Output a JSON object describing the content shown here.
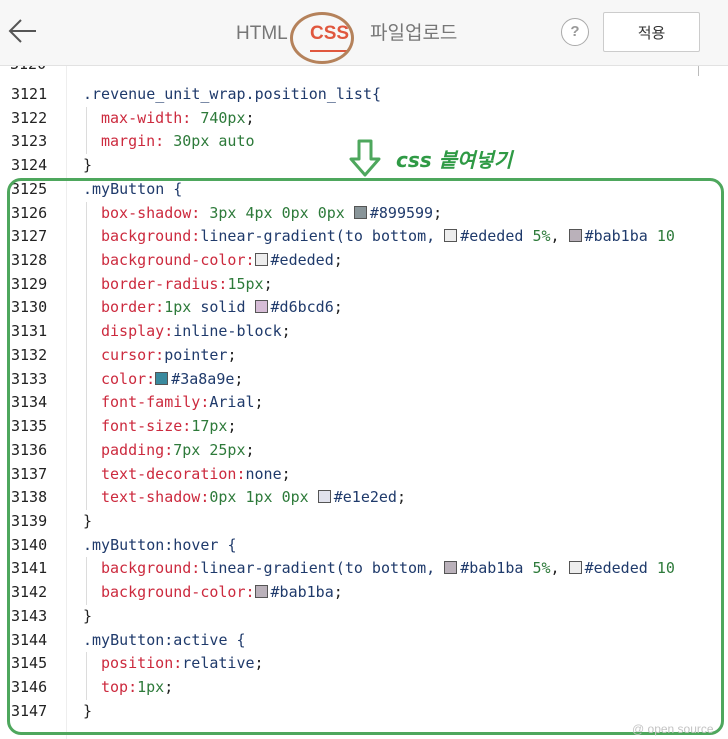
{
  "header": {
    "tabs": [
      {
        "label": "HTML"
      },
      {
        "label": "CSS"
      },
      {
        "label": "파일업로드"
      }
    ],
    "help_label": "?",
    "apply_label": "적용",
    "accent_color": "#e0573e"
  },
  "editor": {
    "partial_line_number": "3120",
    "lines": [
      {
        "no": "3121",
        "indent": false,
        "tokens": [
          {
            "t": ".revenue_unit_wrap.position_list{",
            "c": "sel"
          }
        ]
      },
      {
        "no": "3122",
        "indent": true,
        "tokens": [
          {
            "t": "max-width: ",
            "c": "prop"
          },
          {
            "t": "740px",
            "c": "num"
          },
          {
            "t": ";",
            "c": "punc"
          }
        ]
      },
      {
        "no": "3123",
        "indent": true,
        "tokens": [
          {
            "t": "margin: ",
            "c": "prop"
          },
          {
            "t": "30px auto",
            "c": "num"
          }
        ]
      },
      {
        "no": "3124",
        "indent": false,
        "tokens": [
          {
            "t": "}",
            "c": "punc"
          }
        ]
      },
      {
        "no": "3125",
        "indent": false,
        "tokens": [
          {
            "t": ".myButton {",
            "c": "sel"
          }
        ]
      },
      {
        "no": "3126",
        "indent": true,
        "tokens": [
          {
            "t": "box-shadow: ",
            "c": "prop"
          },
          {
            "t": "3px 4px 0px 0px ",
            "c": "num"
          },
          {
            "sw": "#899599"
          },
          {
            "t": "#899599",
            "c": "val"
          },
          {
            "t": ";",
            "c": "punc"
          }
        ]
      },
      {
        "no": "3127",
        "indent": true,
        "tokens": [
          {
            "t": "background:",
            "c": "prop"
          },
          {
            "t": "linear-gradient(to bottom, ",
            "c": "val"
          },
          {
            "sw": "#ededed"
          },
          {
            "t": "#ededed ",
            "c": "val"
          },
          {
            "t": "5%",
            "c": "num"
          },
          {
            "t": ", ",
            "c": "punc"
          },
          {
            "sw": "#bab1ba"
          },
          {
            "t": "#bab1ba ",
            "c": "val"
          },
          {
            "t": "10",
            "c": "num"
          }
        ]
      },
      {
        "no": "3128",
        "indent": true,
        "tokens": [
          {
            "t": "background-color:",
            "c": "prop"
          },
          {
            "sw": "#ededed"
          },
          {
            "t": "#ededed",
            "c": "val"
          },
          {
            "t": ";",
            "c": "punc"
          }
        ]
      },
      {
        "no": "3129",
        "indent": true,
        "tokens": [
          {
            "t": "border-radius:",
            "c": "prop"
          },
          {
            "t": "15px",
            "c": "num"
          },
          {
            "t": ";",
            "c": "punc"
          }
        ]
      },
      {
        "no": "3130",
        "indent": true,
        "tokens": [
          {
            "t": "border:",
            "c": "prop"
          },
          {
            "t": "1px ",
            "c": "num"
          },
          {
            "t": "solid ",
            "c": "val"
          },
          {
            "sw": "#d6bcd6"
          },
          {
            "t": "#d6bcd6",
            "c": "val"
          },
          {
            "t": ";",
            "c": "punc"
          }
        ]
      },
      {
        "no": "3131",
        "indent": true,
        "tokens": [
          {
            "t": "display:",
            "c": "prop"
          },
          {
            "t": "inline-block",
            "c": "val"
          },
          {
            "t": ";",
            "c": "punc"
          }
        ]
      },
      {
        "no": "3132",
        "indent": true,
        "tokens": [
          {
            "t": "cursor:",
            "c": "prop"
          },
          {
            "t": "pointer",
            "c": "val"
          },
          {
            "t": ";",
            "c": "punc"
          }
        ]
      },
      {
        "no": "3133",
        "indent": true,
        "tokens": [
          {
            "t": "color:",
            "c": "prop"
          },
          {
            "sw": "#3a8a9e"
          },
          {
            "t": "#3a8a9e",
            "c": "val"
          },
          {
            "t": ";",
            "c": "punc"
          }
        ]
      },
      {
        "no": "3134",
        "indent": true,
        "tokens": [
          {
            "t": "font-family:",
            "c": "prop"
          },
          {
            "t": "Arial",
            "c": "val"
          },
          {
            "t": ";",
            "c": "punc"
          }
        ]
      },
      {
        "no": "3135",
        "indent": true,
        "tokens": [
          {
            "t": "font-size:",
            "c": "prop"
          },
          {
            "t": "17px",
            "c": "num"
          },
          {
            "t": ";",
            "c": "punc"
          }
        ]
      },
      {
        "no": "3136",
        "indent": true,
        "tokens": [
          {
            "t": "padding:",
            "c": "prop"
          },
          {
            "t": "7px 25px",
            "c": "num"
          },
          {
            "t": ";",
            "c": "punc"
          }
        ]
      },
      {
        "no": "3137",
        "indent": true,
        "tokens": [
          {
            "t": "text-decoration:",
            "c": "prop"
          },
          {
            "t": "none",
            "c": "val"
          },
          {
            "t": ";",
            "c": "punc"
          }
        ]
      },
      {
        "no": "3138",
        "indent": true,
        "tokens": [
          {
            "t": "text-shadow:",
            "c": "prop"
          },
          {
            "t": "0px 1px 0px ",
            "c": "num"
          },
          {
            "sw": "#e1e2ed"
          },
          {
            "t": "#e1e2ed",
            "c": "val"
          },
          {
            "t": ";",
            "c": "punc"
          }
        ]
      },
      {
        "no": "3139",
        "indent": false,
        "tokens": [
          {
            "t": "}",
            "c": "punc"
          }
        ]
      },
      {
        "no": "3140",
        "indent": false,
        "tokens": [
          {
            "t": ".myButton:hover {",
            "c": "sel"
          }
        ]
      },
      {
        "no": "3141",
        "indent": true,
        "tokens": [
          {
            "t": "background:",
            "c": "prop"
          },
          {
            "t": "linear-gradient(to bottom, ",
            "c": "val"
          },
          {
            "sw": "#bab1ba"
          },
          {
            "t": "#bab1ba ",
            "c": "val"
          },
          {
            "t": "5%",
            "c": "num"
          },
          {
            "t": ", ",
            "c": "punc"
          },
          {
            "sw": "#ededed"
          },
          {
            "t": "#ededed ",
            "c": "val"
          },
          {
            "t": "10",
            "c": "num"
          }
        ]
      },
      {
        "no": "3142",
        "indent": true,
        "tokens": [
          {
            "t": "background-color:",
            "c": "prop"
          },
          {
            "sw": "#bab1ba"
          },
          {
            "t": "#bab1ba",
            "c": "val"
          },
          {
            "t": ";",
            "c": "punc"
          }
        ]
      },
      {
        "no": "3143",
        "indent": false,
        "tokens": [
          {
            "t": "}",
            "c": "punc"
          }
        ]
      },
      {
        "no": "3144",
        "indent": false,
        "tokens": [
          {
            "t": ".myButton:active {",
            "c": "sel"
          }
        ]
      },
      {
        "no": "3145",
        "indent": true,
        "tokens": [
          {
            "t": "position:",
            "c": "prop"
          },
          {
            "t": "relative",
            "c": "val"
          },
          {
            "t": ";",
            "c": "punc"
          }
        ]
      },
      {
        "no": "3146",
        "indent": true,
        "tokens": [
          {
            "t": "top:",
            "c": "prop"
          },
          {
            "t": "1px",
            "c": "num"
          },
          {
            "t": ";",
            "c": "punc"
          }
        ]
      },
      {
        "no": "3147",
        "indent": false,
        "tokens": [
          {
            "t": "}",
            "c": "punc"
          }
        ]
      }
    ]
  },
  "annotation": {
    "text": "css 붙여넣기",
    "color": "#4ea75d"
  },
  "watermark": "@ open source"
}
